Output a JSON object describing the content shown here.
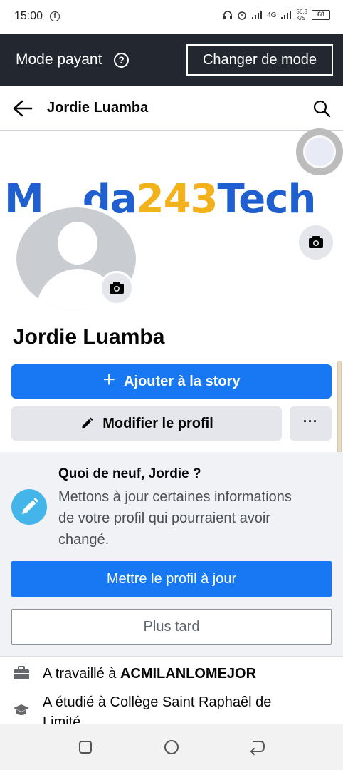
{
  "status_bar": {
    "time": "15:00",
    "fb_icon": "facebook-icon",
    "network_speed": "56,8",
    "network_unit": "K/S",
    "signal_4g": "4G",
    "battery": "68"
  },
  "mode_bar": {
    "label": "Mode payant",
    "help_icon": "?",
    "switch_label": "Changer de mode"
  },
  "app_bar": {
    "title": "Jordie Luamba"
  },
  "cover": {
    "brand_part1": "M",
    "brand_hidden": "…",
    "brand_part2": "da",
    "brand_part3": "243",
    "brand_part4": "Tech"
  },
  "profile": {
    "name": "Jordie Luamba",
    "add_story_label": "Ajouter à la story",
    "edit_profile_label": "Modifier le profil",
    "more_label": "···"
  },
  "update_card": {
    "heading": "Quoi de neuf, Jordie ?",
    "description": "Mettons à jour certaines informations de votre profil qui pourraient avoir changé.",
    "update_button": "Mettre le profil à jour",
    "later_button": "Plus tard"
  },
  "info": {
    "work_prefix": "A travaillé à ",
    "work_place": "ACMILANLOMEJOR",
    "study": "A étudié à Collège Saint Raphaêl de Limité"
  },
  "colors": {
    "accent": "#1877f2",
    "mode_bar_bg": "#23272f",
    "brand_blue": "#1f5fd0",
    "brand_yellow": "#f3b11c"
  }
}
